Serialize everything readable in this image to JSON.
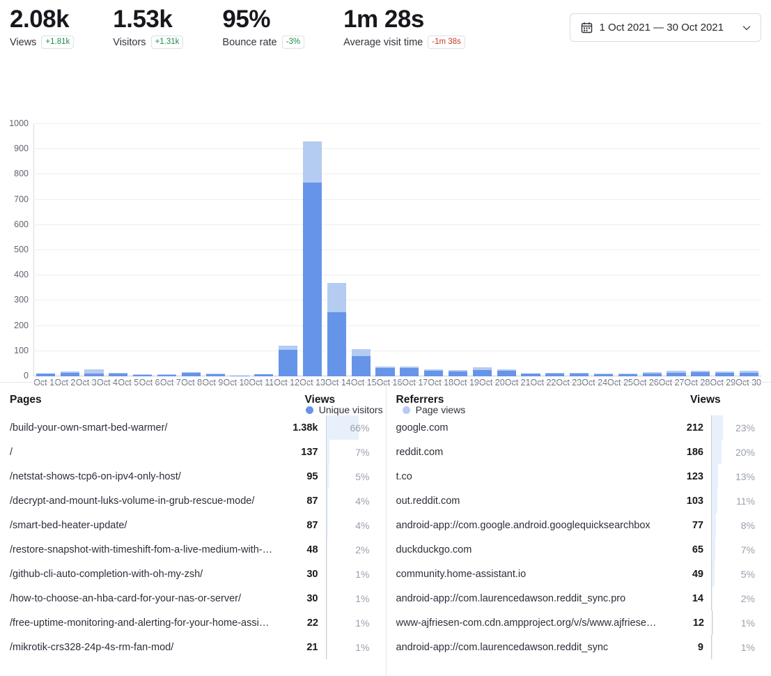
{
  "stats": [
    {
      "value": "2.08k",
      "label": "Views",
      "delta": "+1.81k",
      "delta_dir": "pos"
    },
    {
      "value": "1.53k",
      "label": "Visitors",
      "delta": "+1.31k",
      "delta_dir": "pos"
    },
    {
      "value": "95%",
      "label": "Bounce rate",
      "delta": "-3%",
      "delta_dir": "pos"
    },
    {
      "value": "1m 28s",
      "label": "Average visit time",
      "delta": "-1m 38s",
      "delta_dir": "neg"
    }
  ],
  "datepicker": {
    "range": "1 Oct 2021 — 30 Oct 2021",
    "calendar_icon": "calendar-icon",
    "chevron_icon": "chevron-down-icon"
  },
  "chart_data": {
    "type": "bar",
    "stacked": true,
    "title": "",
    "xlabel": "",
    "ylabel": "",
    "ylim": [
      0,
      1000
    ],
    "yticks": [
      0,
      100,
      200,
      300,
      400,
      500,
      600,
      700,
      800,
      900,
      1000
    ],
    "grid": true,
    "legend_position": "bottom",
    "categories": [
      "Oct 1",
      "Oct 2",
      "Oct 3",
      "Oct 4",
      "Oct 5",
      "Oct 6",
      "Oct 7",
      "Oct 8",
      "Oct 9",
      "Oct 10",
      "Oct 11",
      "Oct 12",
      "Oct 13",
      "Oct 14",
      "Oct 15",
      "Oct 16",
      "Oct 17",
      "Oct 18",
      "Oct 19",
      "Oct 20",
      "Oct 21",
      "Oct 22",
      "Oct 23",
      "Oct 24",
      "Oct 25",
      "Oct 26",
      "Oct 27",
      "Oct 28",
      "Oct 29",
      "Oct 30"
    ],
    "series": [
      {
        "name": "Unique visitors",
        "color": "#6694e8",
        "values": [
          10,
          13,
          11,
          11,
          6,
          6,
          15,
          9,
          4,
          8,
          104,
          767,
          253,
          80,
          33,
          34,
          23,
          20,
          25,
          21,
          11,
          11,
          11,
          9,
          9,
          11,
          15,
          16,
          14,
          13
        ]
      },
      {
        "name": "Page views",
        "color": "#b4cbf2",
        "values": [
          0,
          6,
          18,
          2,
          1,
          1,
          1,
          1,
          0,
          1,
          18,
          165,
          117,
          28,
          6,
          6,
          6,
          5,
          11,
          6,
          1,
          2,
          2,
          2,
          2,
          5,
          6,
          6,
          6,
          10
        ]
      }
    ],
    "legend": [
      "Unique visitors",
      "Page views"
    ]
  },
  "pages_panel": {
    "title": "Pages",
    "views_header": "Views",
    "rows": [
      {
        "label": "/build-your-own-smart-bed-warmer/",
        "count": "1.38k",
        "pct": "66%",
        "pct_value": 66
      },
      {
        "label": "/",
        "count": "137",
        "pct": "7%",
        "pct_value": 7
      },
      {
        "label": "/netstat-shows-tcp6-on-ipv4-only-host/",
        "count": "95",
        "pct": "5%",
        "pct_value": 5
      },
      {
        "label": "/decrypt-and-mount-luks-volume-in-grub-rescue-mode/",
        "count": "87",
        "pct": "4%",
        "pct_value": 4
      },
      {
        "label": "/smart-bed-heater-update/",
        "count": "87",
        "pct": "4%",
        "pct_value": 4
      },
      {
        "label": "/restore-snapshot-with-timeshift-fom-a-live-medium-with-l...",
        "count": "48",
        "pct": "2%",
        "pct_value": 2
      },
      {
        "label": "/github-cli-auto-completion-with-oh-my-zsh/",
        "count": "30",
        "pct": "1%",
        "pct_value": 1
      },
      {
        "label": "/how-to-choose-an-hba-card-for-your-nas-or-server/",
        "count": "30",
        "pct": "1%",
        "pct_value": 1
      },
      {
        "label": "/free-uptime-monitoring-and-alerting-for-your-home-assist...",
        "count": "22",
        "pct": "1%",
        "pct_value": 1
      },
      {
        "label": "/mikrotik-crs328-24p-4s-rm-fan-mod/",
        "count": "21",
        "pct": "1%",
        "pct_value": 1
      }
    ]
  },
  "referrers_panel": {
    "title": "Referrers",
    "views_header": "Views",
    "rows": [
      {
        "label": "google.com",
        "count": "212",
        "pct": "23%",
        "pct_value": 23
      },
      {
        "label": "reddit.com",
        "count": "186",
        "pct": "20%",
        "pct_value": 20
      },
      {
        "label": "t.co",
        "count": "123",
        "pct": "13%",
        "pct_value": 13
      },
      {
        "label": "out.reddit.com",
        "count": "103",
        "pct": "11%",
        "pct_value": 11
      },
      {
        "label": "android-app://com.google.android.googlequicksearchbox",
        "count": "77",
        "pct": "8%",
        "pct_value": 8
      },
      {
        "label": "duckduckgo.com",
        "count": "65",
        "pct": "7%",
        "pct_value": 7
      },
      {
        "label": "community.home-assistant.io",
        "count": "49",
        "pct": "5%",
        "pct_value": 5
      },
      {
        "label": "android-app://com.laurencedawson.reddit_sync.pro",
        "count": "14",
        "pct": "2%",
        "pct_value": 2
      },
      {
        "label": "www-ajfriesen-com.cdn.ampproject.org/v/s/www.ajfriesen....",
        "count": "12",
        "pct": "1%",
        "pct_value": 1
      },
      {
        "label": "android-app://com.laurencedawson.reddit_sync",
        "count": "9",
        "pct": "1%",
        "pct_value": 1
      }
    ]
  }
}
